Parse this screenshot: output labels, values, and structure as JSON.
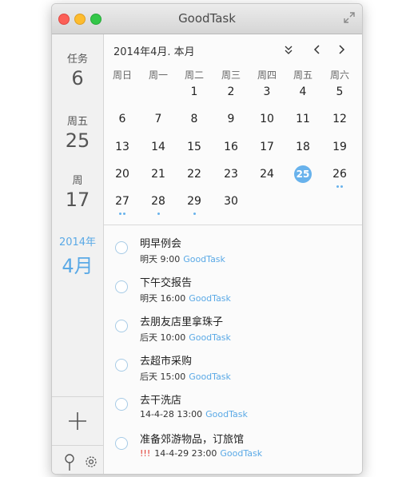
{
  "window": {
    "title": "GoodTask"
  },
  "sidebar": {
    "blocks": [
      {
        "label": "任务",
        "value": "6"
      },
      {
        "label": "周五",
        "value": "25"
      },
      {
        "label": "周",
        "value": "17"
      },
      {
        "label": "2014年",
        "value": "4月"
      }
    ]
  },
  "calendar": {
    "month_title": "2014年4月. 本月",
    "weekdays": [
      "周日",
      "周一",
      "周二",
      "周三",
      "周四",
      "周五",
      "周六"
    ],
    "weeks": [
      [
        "",
        "",
        "1",
        "2",
        "3",
        "4",
        "5"
      ],
      [
        "6",
        "7",
        "8",
        "9",
        "10",
        "11",
        "12"
      ],
      [
        "13",
        "14",
        "15",
        "16",
        "17",
        "18",
        "19"
      ],
      [
        "20",
        "21",
        "22",
        "23",
        "24",
        "25",
        "26"
      ],
      [
        "27",
        "28",
        "29",
        "30",
        "",
        "",
        ""
      ]
    ],
    "today": "25",
    "dots": {
      "26": 2,
      "27": 2,
      "28": 1,
      "29": 1
    },
    "accent": "#68b2ec"
  },
  "tasks": [
    {
      "title": "明早例会",
      "date": "明天 9:00",
      "list": "GoodTask",
      "priority": ""
    },
    {
      "title": "下午交报告",
      "date": "明天 16:00",
      "list": "GoodTask",
      "priority": ""
    },
    {
      "title": "去朋友店里拿珠子",
      "date": "后天 10:00",
      "list": "GoodTask",
      "priority": ""
    },
    {
      "title": "去超市采购",
      "date": "后天 15:00",
      "list": "GoodTask",
      "priority": ""
    },
    {
      "title": "去干洗店",
      "date": "14-4-28 13:00",
      "list": "GoodTask",
      "priority": ""
    },
    {
      "title": "准备郊游物品，订旅馆",
      "date": "14-4-29 23:00",
      "list": "GoodTask",
      "priority": "!!!"
    }
  ]
}
